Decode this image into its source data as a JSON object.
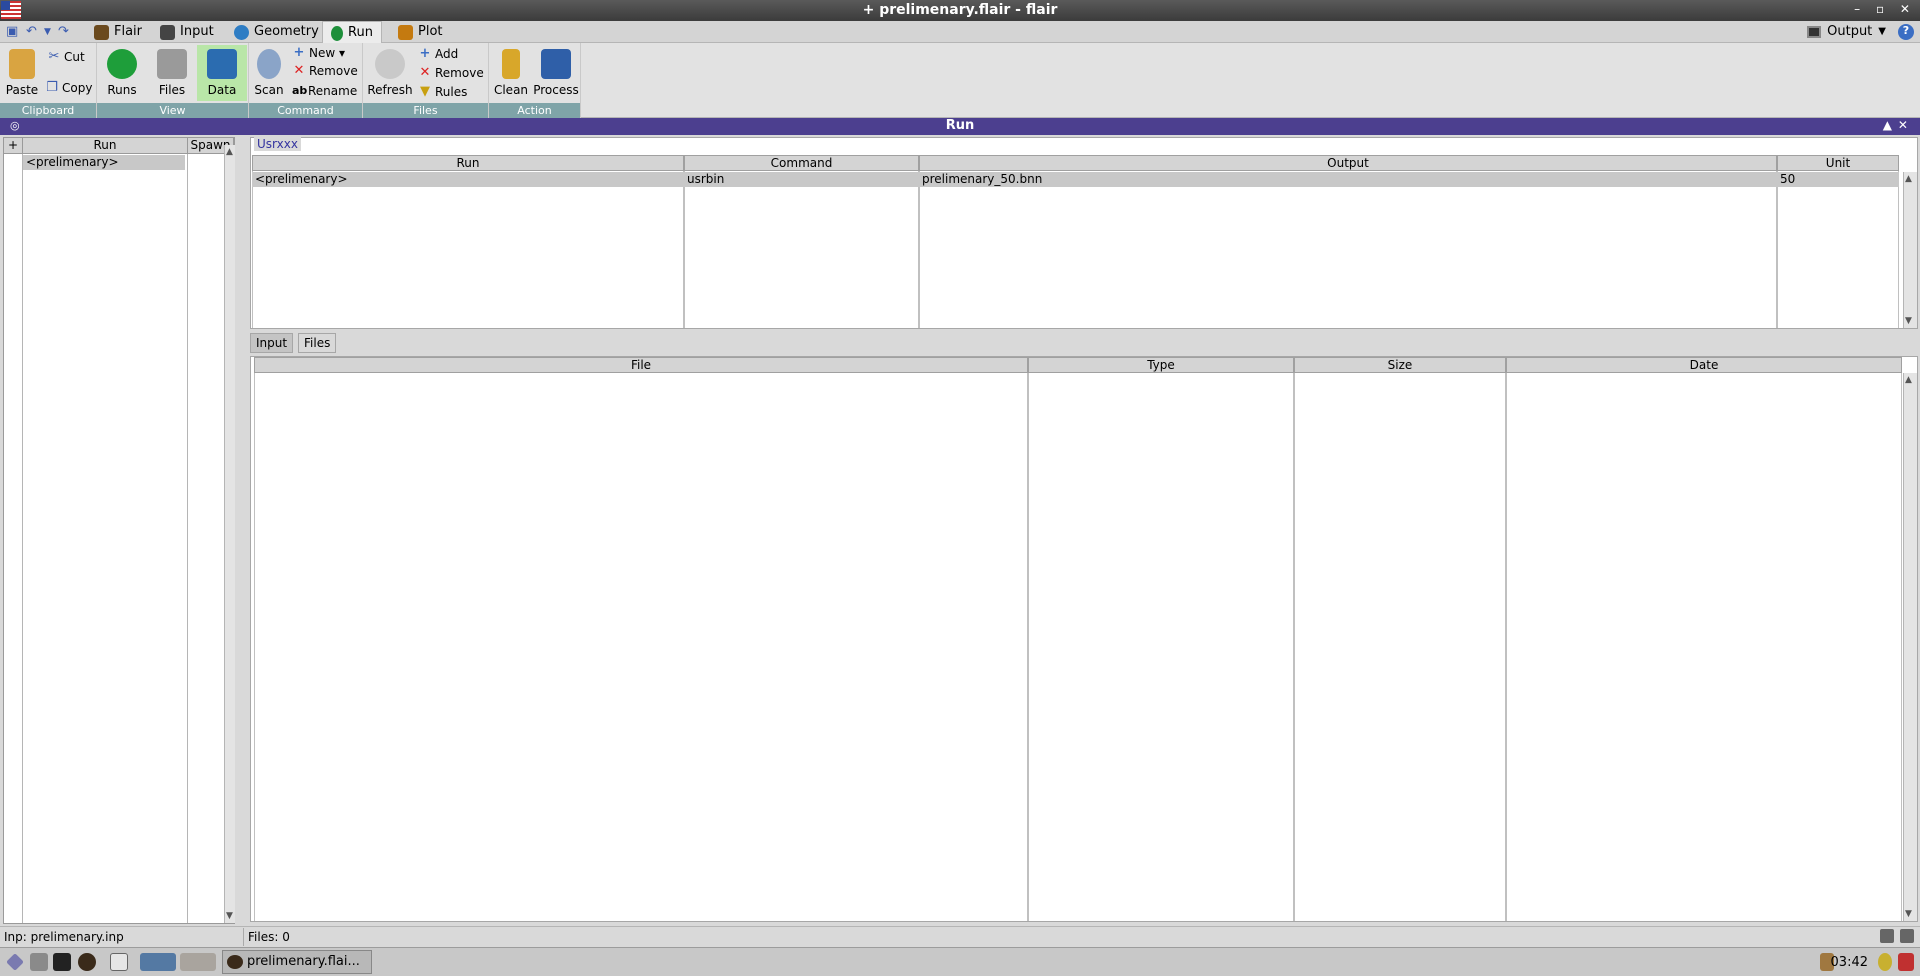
{
  "window": {
    "title": "+ prelimenary.flair - flair"
  },
  "menu": {
    "tabs": [
      {
        "label": "Flair",
        "color": "#6b4a1e"
      },
      {
        "label": "Input",
        "color": "#444444"
      },
      {
        "label": "Geometry",
        "color": "#2e7dc4"
      },
      {
        "label": "Run",
        "color": "#1e8f3a"
      },
      {
        "label": "Plot",
        "color": "#c47a10"
      }
    ],
    "active_tab": "Run",
    "output_label": "Output"
  },
  "ribbon": {
    "groups": {
      "clipboard": "Clipboard",
      "view": "View",
      "command": "Command",
      "files": "Files",
      "action": "Action"
    },
    "paste": "Paste",
    "cut": "Cut",
    "copy": "Copy",
    "runs": "Runs",
    "files_btn": "Files",
    "data": "Data",
    "scan": "Scan",
    "new": "New ▾",
    "remove_cmd": "Remove",
    "rename": "Rename",
    "refresh": "Refresh",
    "add": "Add",
    "remove_files": "Remove",
    "rules": "Rules",
    "clean": "Clean",
    "process": "Process"
  },
  "panel": {
    "title": "Run"
  },
  "run_list": {
    "plus": "+",
    "headers": {
      "run": "Run",
      "spawn": "Spawn"
    },
    "rows": [
      {
        "run": "<prelimenary>",
        "spawn": ""
      }
    ]
  },
  "usrxxx": {
    "label": "Usrxxx",
    "headers": {
      "run": "Run",
      "command": "Command",
      "output": "Output",
      "unit": "Unit"
    },
    "rows": [
      {
        "run": "<prelimenary>",
        "command": "usrbin",
        "output": "prelimenary_50.bnn",
        "unit": "50"
      }
    ]
  },
  "subtabs": {
    "input": "Input",
    "files": "Files"
  },
  "files_table": {
    "headers": {
      "file": "File",
      "type": "Type",
      "size": "Size",
      "date": "Date"
    }
  },
  "status": {
    "inp": "Inp: prelimenary.inp",
    "files": "Files: 0"
  },
  "taskbar": {
    "item": "prelimenary.flai...",
    "clock": "03:42"
  }
}
